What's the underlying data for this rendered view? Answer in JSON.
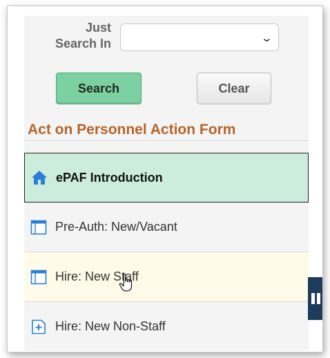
{
  "search": {
    "label": "Just\nSearch In",
    "selected_value": "",
    "search_button": "Search",
    "clear_button": "Clear"
  },
  "section": {
    "title": "Act on Personnel Action Form"
  },
  "nav": {
    "items": [
      {
        "label": "ePAF Introduction",
        "icon": "home-icon",
        "state": "active"
      },
      {
        "label": "Pre-Auth: New/Vacant",
        "icon": "form-icon",
        "state": "normal"
      },
      {
        "label": "Hire: New Staff",
        "icon": "form-icon",
        "state": "hover"
      },
      {
        "label": "Hire: New Non-Staff",
        "icon": "add-form-icon",
        "state": "normal"
      }
    ]
  },
  "colors": {
    "accent_green": "#7dd0a1",
    "active_bg": "#ccecdc",
    "section_title": "#b5652a",
    "side_tab": "#1d3b5a"
  }
}
